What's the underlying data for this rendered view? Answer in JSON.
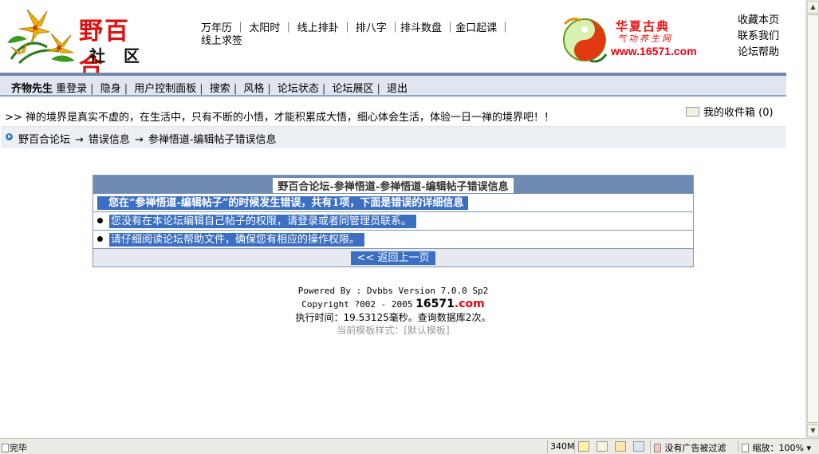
{
  "header": {
    "logo_title": "野百合",
    "logo_subtitle": "社 区",
    "top_links": [
      "万年历",
      "太阳时",
      "线上排卦",
      "排八字",
      "排斗数盘",
      "金口起课",
      "线上求签"
    ],
    "ad": {
      "title": "华夏古典",
      "subtitle": "气功养生网",
      "url": "www.16571.com"
    },
    "right_links": [
      "收藏本页",
      "联系我们",
      "论坛帮助"
    ]
  },
  "nav": {
    "username": "齐物先生",
    "items": [
      "重登录",
      "隐身",
      "用户控制面板",
      "搜索",
      "风格",
      "论坛状态",
      "论坛展区",
      "退出"
    ]
  },
  "marquee": {
    "prefix": ">>",
    "text": "禅的境界是真实不虚的，在生活中，只有不断的小悟，才能积累成大悟，细心体会生活，体验一日一禅的境界吧！！"
  },
  "inbox": {
    "label": "我的收件箱",
    "count": "(0)"
  },
  "breadcrumb": [
    "野百合论坛",
    "错误信息",
    "参禅悟道-编辑帖子错误信息"
  ],
  "error": {
    "heading": "野百合论坛-参禅悟道-参禅悟道-编辑帖子错误信息",
    "summary": "您在“参禅悟道-编辑帖子”的时候发生错误，共有1项，下面是错误的详细信息",
    "details": [
      "您没有在本论坛编辑自己帖子的权限，请登录或者同管理员联系。",
      "请仔细阅读论坛帮助文件，确保您有相应的操作权限。"
    ],
    "back_label": "<< 返回上一页"
  },
  "footer": {
    "powered": "Powered By : Dvbbs Version 7.0.0 Sp2",
    "copyright": "Copyright ?002 - 2005",
    "brand_num": "16571",
    "brand_com": ".com",
    "exec": "执行时间：19.53125毫秒。查询数据库2次。",
    "template": "当前模板样式：[默认模板]"
  },
  "statusbar": {
    "status": "完毕",
    "memory": "340M",
    "ad_filter": "没有广告被过滤",
    "zoom": "缩放：100%"
  }
}
